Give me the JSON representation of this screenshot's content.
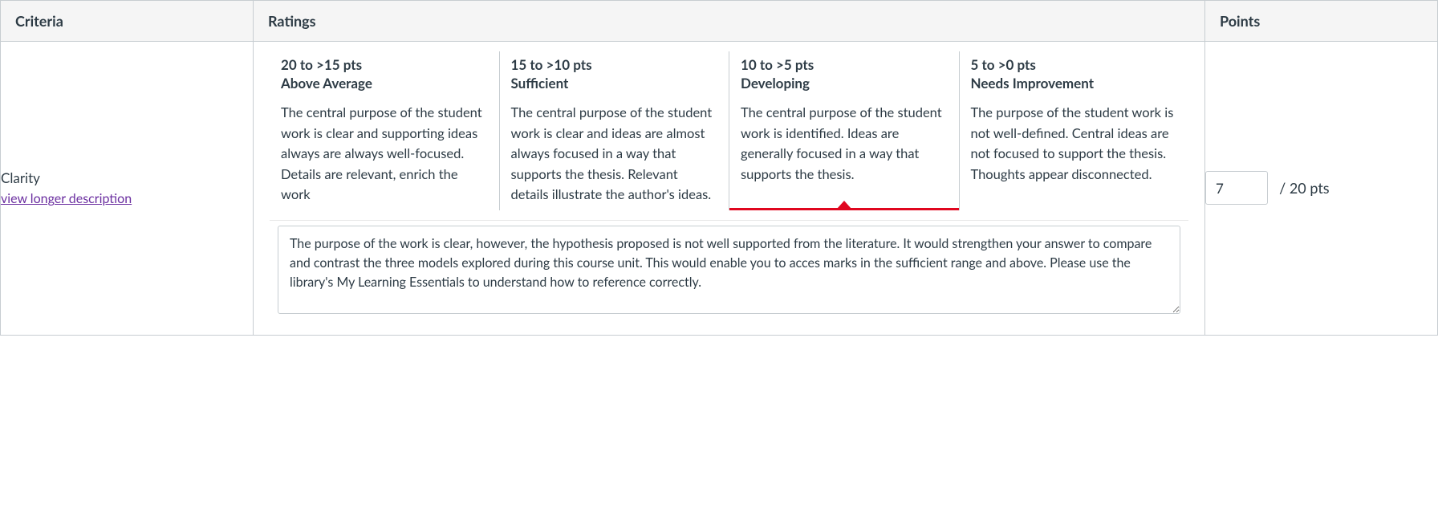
{
  "headers": {
    "criteria": "Criteria",
    "ratings": "Ratings",
    "points": "Points"
  },
  "row": {
    "criterion_name": "Clarity",
    "long_desc_link": "view longer description",
    "ratings": [
      {
        "points_range": "20 to >15 pts",
        "title": "Above Average",
        "description": "The central purpose of the student work is clear and supporting ideas always are always well-focused. Details are relevant, enrich the work",
        "selected": false
      },
      {
        "points_range": "15 to >10 pts",
        "title": "Sufficient",
        "description": "The central purpose of the student work is clear and ideas are almost always focused in a way that supports the thesis. Relevant details illustrate the author's ideas.",
        "selected": false
      },
      {
        "points_range": "10 to >5 pts",
        "title": "Developing",
        "description": "The central purpose of the student work is identified. Ideas are generally focused in a way that supports the thesis.",
        "selected": true
      },
      {
        "points_range": "5 to >0 pts",
        "title": "Needs Improvement",
        "description": "The purpose of the student work is not well-defined. Central ideas are not focused to support the thesis. Thoughts appear disconnected.",
        "selected": false
      }
    ],
    "comment": "The purpose of the work is clear, however, the hypothesis proposed is not well supported from the literature. It would strengthen your answer to compare and contrast the three models explored during this course unit. This would enable you to acces marks in the sufficient range and above. Please use the library's My Learning Essentials to understand how to reference correctly.",
    "points_value": "7",
    "points_max_label": "/ 20 pts"
  }
}
